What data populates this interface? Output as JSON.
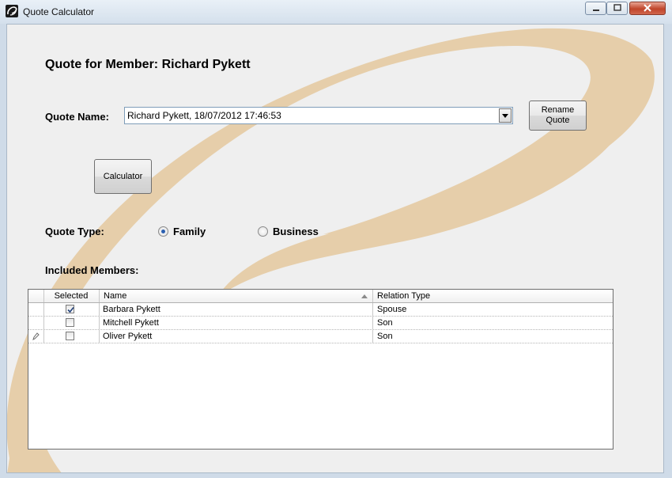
{
  "window": {
    "title": "Quote Calculator"
  },
  "heading": "Quote for Member: Richard Pykett",
  "quote_name": {
    "label": "Quote Name:",
    "value": "Richard Pykett, 18/07/2012 17:46:53"
  },
  "buttons": {
    "rename_line1": "Rename",
    "rename_line2": "Quote",
    "calculator": "Calculator"
  },
  "quote_type": {
    "label": "Quote Type:",
    "option_family": "Family",
    "option_business": "Business",
    "selected": "Family"
  },
  "members": {
    "label": "Included Members:",
    "columns": [
      "Selected",
      "Name",
      "Relation Type"
    ],
    "rows": [
      {
        "selected": true,
        "name": "Barbara Pykett",
        "relation": "Spouse"
      },
      {
        "selected": false,
        "name": "Mitchell Pykett",
        "relation": "Son"
      },
      {
        "selected": false,
        "name": "Oliver Pykett",
        "relation": "Son"
      }
    ]
  },
  "colors": {
    "swirl": "#e6ceaa",
    "radio_selected": "#2a5fb0"
  }
}
